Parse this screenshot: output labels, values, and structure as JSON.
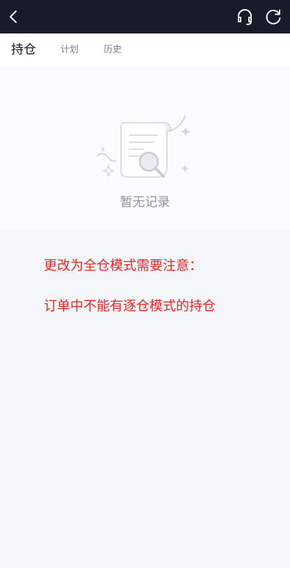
{
  "header": {
    "back_icon": "chevron-left-icon",
    "support_icon": "headset-icon",
    "refresh_icon": "refresh-icon",
    "background": "#171b2a"
  },
  "tabs": [
    {
      "label": "持仓",
      "active": true
    },
    {
      "label": "计划",
      "active": false
    },
    {
      "label": "历史",
      "active": false
    }
  ],
  "empty_state": {
    "icon": "empty-document-search-icon",
    "text": "暂无记录"
  },
  "notice": {
    "line1": "更改为全仓模式需要注意：",
    "line2": "订单中不能有逐仓模式的持仓",
    "color": "#ee2424"
  }
}
